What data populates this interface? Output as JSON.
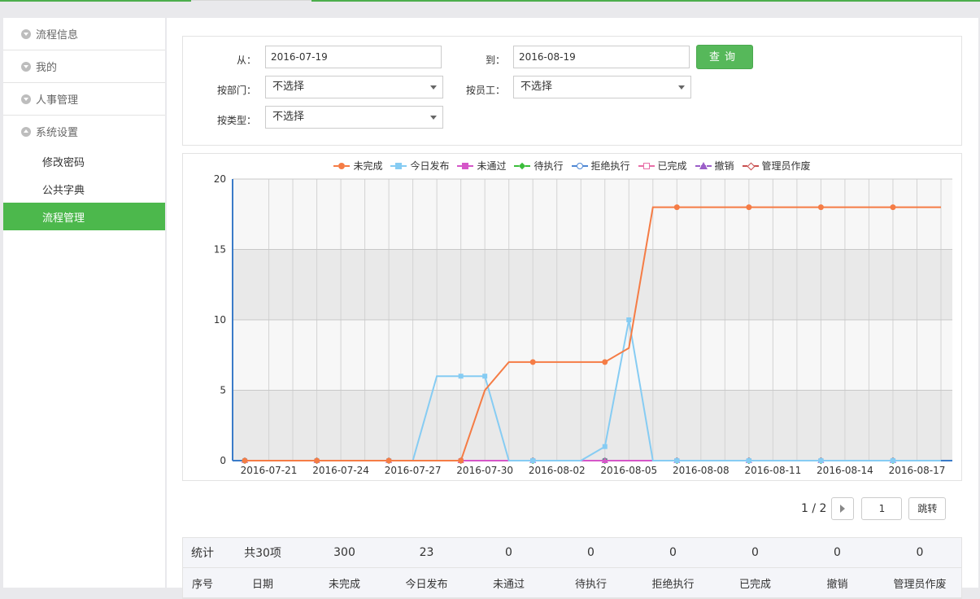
{
  "sidebar": {
    "groups": [
      {
        "label": "流程信息",
        "expanded": false
      },
      {
        "label": "我的",
        "expanded": false
      },
      {
        "label": "人事管理",
        "expanded": false
      },
      {
        "label": "系统设置",
        "expanded": true
      }
    ],
    "sub_items": [
      {
        "label": "修改密码",
        "active": false
      },
      {
        "label": "公共字典",
        "active": false
      },
      {
        "label": "流程管理",
        "active": true
      }
    ]
  },
  "filter": {
    "from_label": "从：",
    "from_value": "2016-07-19",
    "to_label": "到：",
    "to_value": "2016-08-19",
    "query_button": "查询",
    "dept_label": "按部门：",
    "dept_value": "不选择",
    "employee_label": "按员工：",
    "employee_value": "不选择",
    "type_label": "按类型：",
    "type_value": "不选择"
  },
  "chart_data": {
    "type": "line",
    "ylim": [
      0,
      20
    ],
    "yticks": [
      0,
      5,
      10,
      15,
      20
    ],
    "x_tick_labels": [
      "2016-07-21",
      "2016-07-24",
      "2016-07-27",
      "2016-07-30",
      "2016-08-02",
      "2016-08-05",
      "2016-08-08",
      "2016-08-11",
      "2016-08-14",
      "2016-08-17"
    ],
    "x": [
      "2016-07-20",
      "2016-07-21",
      "2016-07-22",
      "2016-07-23",
      "2016-07-24",
      "2016-07-25",
      "2016-07-26",
      "2016-07-27",
      "2016-07-28",
      "2016-07-29",
      "2016-07-30",
      "2016-07-31",
      "2016-08-01",
      "2016-08-02",
      "2016-08-03",
      "2016-08-04",
      "2016-08-05",
      "2016-08-06",
      "2016-08-07",
      "2016-08-08",
      "2016-08-09",
      "2016-08-10",
      "2016-08-11",
      "2016-08-12",
      "2016-08-13",
      "2016-08-14",
      "2016-08-15",
      "2016-08-16",
      "2016-08-17",
      "2016-08-18"
    ],
    "legend_position": "top-center",
    "series": [
      {
        "name": "未完成",
        "color": "#f57c45",
        "marker": "circle",
        "values": [
          0,
          0,
          0,
          0,
          0,
          0,
          0,
          0,
          0,
          0,
          5,
          7,
          7,
          7,
          7,
          7,
          8,
          18,
          18,
          18,
          18,
          18,
          18,
          18,
          18,
          18,
          18,
          18,
          18,
          18
        ]
      },
      {
        "name": "今日发布",
        "color": "#86ccf3",
        "marker": "square",
        "values": [
          0,
          0,
          0,
          0,
          0,
          0,
          0,
          0,
          6,
          6,
          6,
          0,
          0,
          0,
          0,
          1,
          10,
          0,
          0,
          0,
          0,
          0,
          0,
          0,
          0,
          0,
          0,
          0,
          0,
          0
        ]
      },
      {
        "name": "未通过",
        "color": "#d557c8",
        "marker": "triangle",
        "values": [
          0,
          0,
          0,
          0,
          0,
          0,
          0,
          0,
          0,
          0,
          0,
          0,
          0,
          0,
          0,
          0,
          0,
          0,
          0,
          0,
          0,
          0,
          0,
          0,
          0,
          0,
          0,
          0,
          0,
          0
        ]
      },
      {
        "name": "待执行",
        "color": "#3bbd3b",
        "marker": "diamond",
        "values": [
          0,
          0,
          0,
          0,
          0,
          0,
          0,
          0,
          0,
          0,
          0,
          0,
          0,
          0,
          0,
          0,
          0,
          0,
          0,
          0,
          0,
          0,
          0,
          0,
          0,
          0,
          0,
          0,
          0,
          0
        ]
      },
      {
        "name": "拒绝执行",
        "color": "#4e87d4",
        "marker": "ocircle",
        "values": [
          0,
          0,
          0,
          0,
          0,
          0,
          0,
          0,
          0,
          0,
          0,
          0,
          0,
          0,
          0,
          0,
          0,
          0,
          0,
          0,
          0,
          0,
          0,
          0,
          0,
          0,
          0,
          0,
          0,
          0
        ]
      },
      {
        "name": "已完成",
        "color": "#e86fa8",
        "marker": "osquare",
        "values": [
          0,
          0,
          0,
          0,
          0,
          0,
          0,
          0,
          0,
          0,
          0,
          0,
          0,
          0,
          0,
          0,
          0,
          0,
          0,
          0,
          0,
          0,
          0,
          0,
          0,
          0,
          0,
          0,
          0,
          0
        ]
      },
      {
        "name": "撤销",
        "color": "#9b5ec8",
        "marker": "otri",
        "values": [
          0,
          0,
          0,
          0,
          0,
          0,
          0,
          0,
          0,
          0,
          0,
          0,
          0,
          0,
          0,
          0,
          0,
          0,
          0,
          0,
          0,
          0,
          0,
          0,
          0,
          0,
          0,
          0,
          0,
          0
        ]
      },
      {
        "name": "管理员作废",
        "color": "#c94f4f",
        "marker": "odiamond",
        "values": [
          0,
          0,
          0,
          0,
          0,
          0,
          0,
          0,
          0,
          0,
          0,
          0,
          0,
          0,
          0,
          0,
          0,
          0,
          0,
          0,
          0,
          0,
          0,
          0,
          0,
          0,
          0,
          0,
          0,
          0
        ]
      }
    ]
  },
  "pager": {
    "page_info": "1 / 2",
    "page_input": "1",
    "jump_label": "跳转"
  },
  "stats": {
    "summary": [
      "统计",
      "共30项",
      "300",
      "23",
      "0",
      "0",
      "0",
      "0",
      "0",
      "0"
    ],
    "headers": [
      "序号",
      "日期",
      "未完成",
      "今日发布",
      "未通过",
      "待执行",
      "拒绝执行",
      "已完成",
      "撤销",
      "管理员作废"
    ]
  }
}
